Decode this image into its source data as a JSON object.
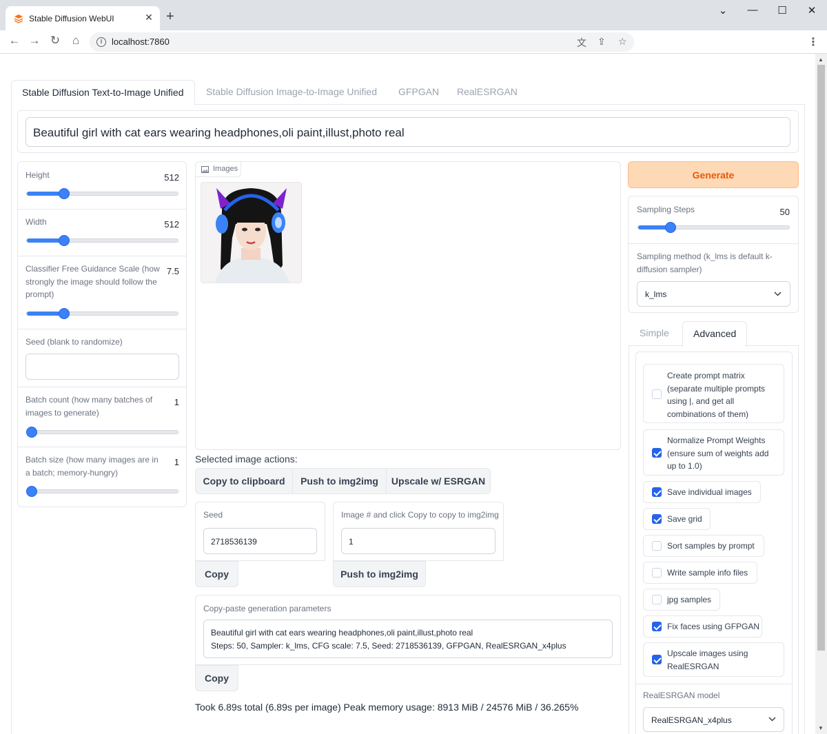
{
  "browser": {
    "tab_title": "Stable Diffusion WebUI",
    "url": "localhost:7860"
  },
  "tabs": [
    {
      "label": "Stable Diffusion Text-to-Image Unified",
      "active": true
    },
    {
      "label": "Stable Diffusion Image-to-Image Unified",
      "active": false
    },
    {
      "label": "GFPGAN",
      "active": false
    },
    {
      "label": "RealESRGAN",
      "active": false
    }
  ],
  "prompt": {
    "value": "Beautiful girl with cat ears wearing headphones,oli paint,illust,photo real"
  },
  "left": {
    "height": {
      "label": "Height",
      "value": "512",
      "fraction": 0.25
    },
    "width": {
      "label": "Width",
      "value": "512",
      "fraction": 0.25
    },
    "cfg": {
      "label": "Classifier Free Guidance Scale (how strongly the image should follow the prompt)",
      "value": "7.5",
      "fraction": 0.25
    },
    "seed": {
      "label": "Seed (blank to randomize)",
      "value": ""
    },
    "batch_count": {
      "label": "Batch count (how many batches of images to generate)",
      "value": "1",
      "fraction": 0.0
    },
    "batch_size": {
      "label": "Batch size (how many images are in a batch; memory-hungry)",
      "value": "1",
      "fraction": 0.0
    }
  },
  "center": {
    "gallery_label": "Images",
    "actions_label": "Selected image actions:",
    "copy_clipboard": "Copy to clipboard",
    "push_img2img": "Push to img2img",
    "upscale": "Upscale w/ ESRGAN",
    "seed_label": "Seed",
    "seed_value": "2718536139",
    "copy": "Copy",
    "image_index_label": "Image # and click Copy to copy to img2img",
    "image_index_value": "1",
    "push_img2img_2": "Push to img2img",
    "params_label": "Copy-paste generation parameters",
    "params_line1": "Beautiful girl with cat ears wearing headphones,oli paint,illust,photo real",
    "params_line2": "Steps: 50, Sampler: k_lms, CFG scale: 7.5, Seed: 2718536139, GFPGAN, RealESRGAN_x4plus",
    "copy2": "Copy",
    "stats": "Took 6.89s total (6.89s per image) Peak memory usage: 8913 MiB / 24576 MiB / 36.265%"
  },
  "right": {
    "generate": "Generate",
    "steps": {
      "label": "Sampling Steps",
      "value": "50",
      "fraction": 0.2
    },
    "sampler_label": "Sampling method (k_lms is default k-diffusion sampler)",
    "sampler_value": "k_lms",
    "subtab_simple": "Simple",
    "subtab_advanced": "Advanced",
    "opt_prompt_matrix": "Create prompt matrix (separate multiple prompts using |, and get all combinations of them)",
    "opt_normalize": "Normalize Prompt Weights (ensure sum of weights add up to 1.0)",
    "opt_save_individual": "Save individual images",
    "opt_save_grid": "Save grid",
    "opt_sort": "Sort samples by prompt",
    "opt_write_info": "Write sample info files",
    "opt_jpg": "jpg samples",
    "opt_fix_faces": "Fix faces using GFPGAN",
    "opt_upscale": "Upscale images using RealESRGAN",
    "model_label": "RealESRGAN model",
    "model_value": "RealESRGAN_x4plus"
  },
  "colors": {
    "accent": "#3b82f6",
    "generate_bg": "#fdd9b5",
    "generate_text": "#ea580c"
  }
}
